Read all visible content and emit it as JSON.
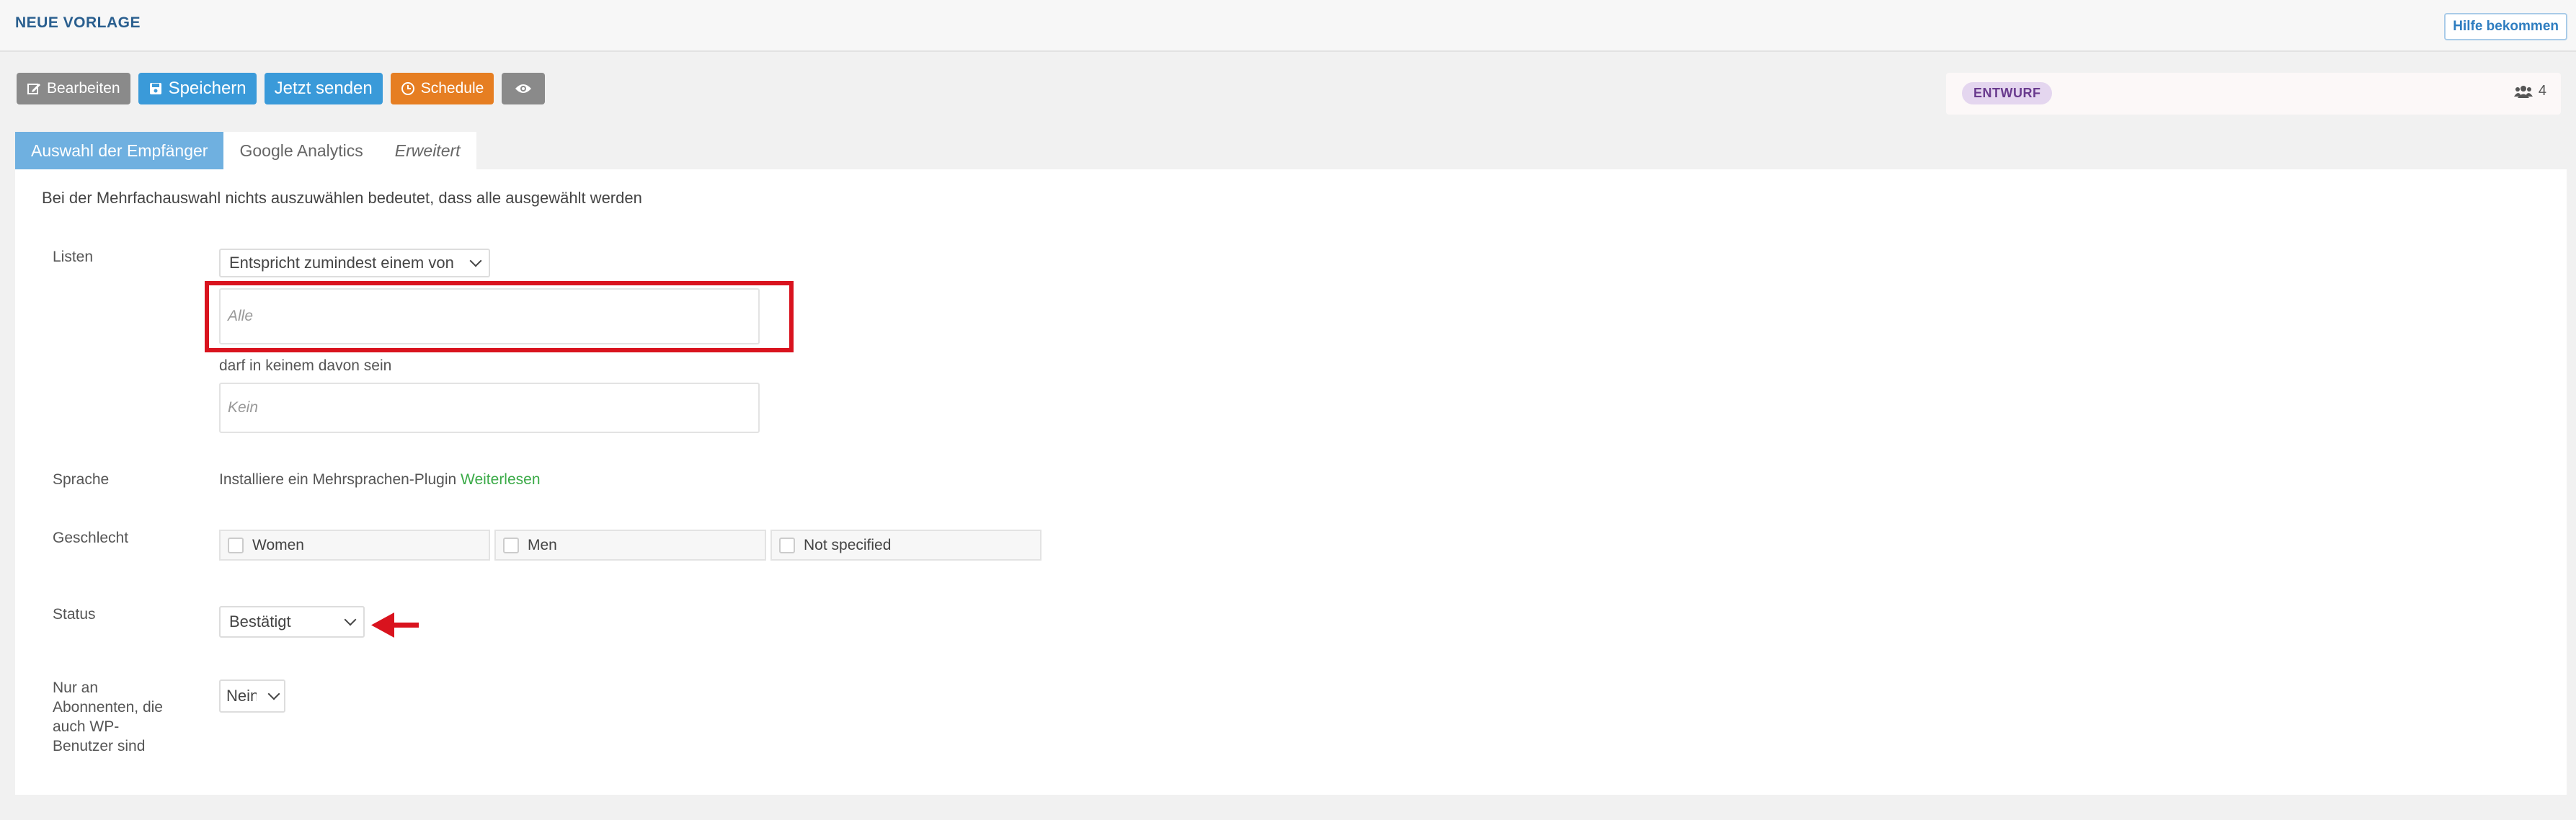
{
  "header": {
    "title": "NEUE VORLAGE",
    "help_label": "Hilfe bekommen"
  },
  "toolbar": {
    "edit_label": "Bearbeiten",
    "save_label": "Speichern",
    "send_label": "Jetzt senden",
    "schedule_label": "Schedule"
  },
  "status_panel": {
    "badge": "ENTWURF",
    "subscriber_count": "4"
  },
  "tabs": [
    {
      "label": "Auswahl der Empfänger",
      "active": true
    },
    {
      "label": "Google Analytics",
      "active": false
    },
    {
      "label": "Erweitert",
      "active": false
    }
  ],
  "form": {
    "hint": "Bei der Mehrfachauswahl nichts auszuwählen bedeutet, dass alle ausgewählt werden",
    "lists": {
      "label": "Listen",
      "match_mode": "Entspricht zumindest einem von",
      "include_placeholder": "Alle",
      "exclude_label": "darf in keinem davon sein",
      "exclude_placeholder": "Kein"
    },
    "language": {
      "label": "Sprache",
      "text": "Installiere ein Mehrsprachen-Plugin",
      "link": "Weiterlesen"
    },
    "gender": {
      "label": "Geschlecht",
      "options": [
        "Women",
        "Men",
        "Not specified"
      ]
    },
    "status": {
      "label": "Status",
      "value": "Bestätigt"
    },
    "wp_users": {
      "label_lines": [
        "Nur an",
        "Abonnenten, die",
        "auch WP-",
        "Benutzer sind"
      ],
      "value": "Nein"
    }
  },
  "colors": {
    "accent": "#3a9ad9",
    "tab_active": "#6fb0e0",
    "schedule": "#e67e22",
    "highlight": "#d9131e",
    "link": "#3aaa47"
  }
}
